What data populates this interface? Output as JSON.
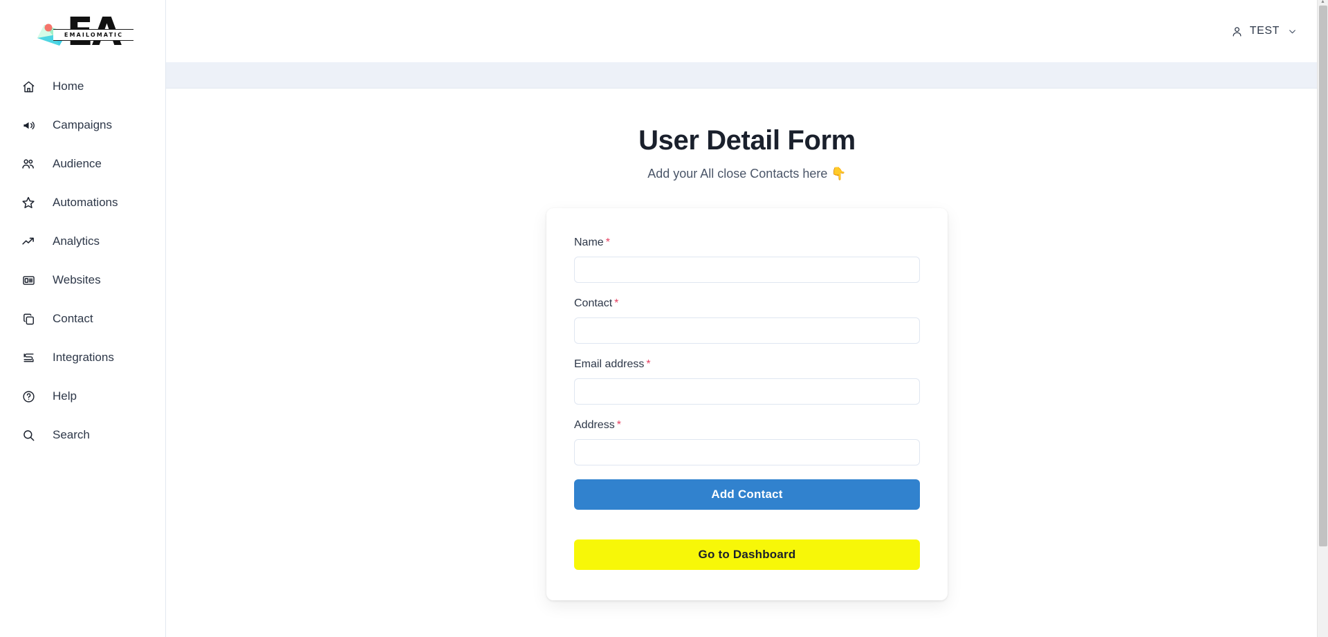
{
  "brand": {
    "logo_mark": "envelope-icon",
    "logo_initials": "EA",
    "logo_wordmark": "EMAILOMATIC",
    "envelope_color": "#9ff0c8",
    "envelope_accent_color": "#3fd0e8",
    "envelope_dot_color": "#f4756b"
  },
  "sidebar": {
    "items": [
      {
        "label": "Home",
        "icon": "home-icon"
      },
      {
        "label": "Campaigns",
        "icon": "megaphone-icon"
      },
      {
        "label": "Audience",
        "icon": "users-icon"
      },
      {
        "label": "Automations",
        "icon": "star-icon"
      },
      {
        "label": "Analytics",
        "icon": "trending-up-icon"
      },
      {
        "label": "Websites",
        "icon": "id-card-icon"
      },
      {
        "label": "Contact",
        "icon": "copy-icon"
      },
      {
        "label": "Integrations",
        "icon": "layers-icon"
      },
      {
        "label": "Help",
        "icon": "question-circle-icon"
      },
      {
        "label": "Search",
        "icon": "search-icon"
      }
    ]
  },
  "topbar": {
    "user_icon": "person-icon",
    "user_name": "TEST",
    "caret_icon": "chevron-down-icon"
  },
  "main": {
    "title": "User Detail Form",
    "subtitle": "Add your All close Contacts here 👇",
    "required_marker": "*",
    "fields": [
      {
        "label": "Name",
        "value": "",
        "placeholder": ""
      },
      {
        "label": "Contact",
        "value": "",
        "placeholder": ""
      },
      {
        "label": "Email address",
        "value": "",
        "placeholder": ""
      },
      {
        "label": "Address",
        "value": "",
        "placeholder": ""
      }
    ],
    "submit_label": "Add Contact",
    "dashboard_label": "Go to Dashboard"
  },
  "colors": {
    "primary_button": "#3182ce",
    "dashboard_button": "#f7f708",
    "required_asterisk": "#e53e5f",
    "subbar": "#edf1f8"
  },
  "scrollbar": {
    "up_arrow_icon": "chevron-up-icon"
  }
}
